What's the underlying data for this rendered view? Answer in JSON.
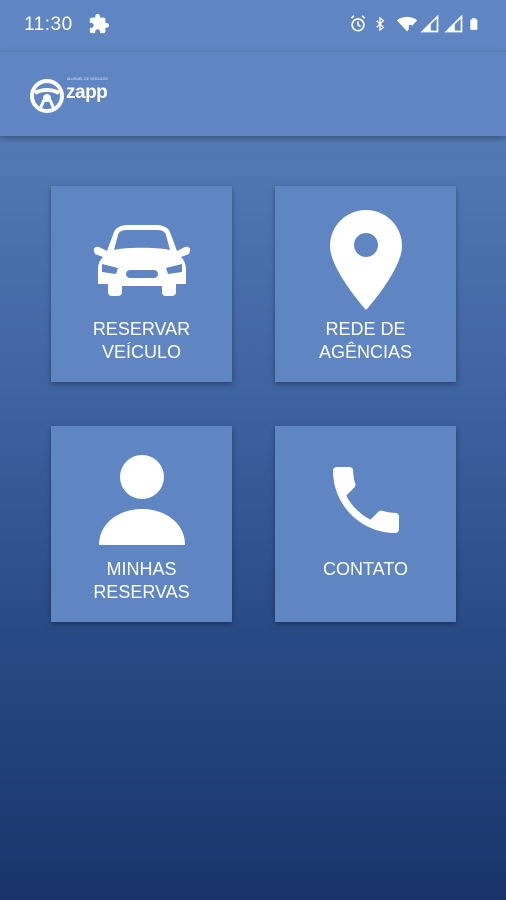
{
  "status_bar": {
    "time": "11:30",
    "icons": [
      "puzzle-icon",
      "alarm-icon",
      "bluetooth-icon",
      "wifi-icon",
      "signal-icon",
      "signal-icon",
      "battery-icon"
    ]
  },
  "app_bar": {
    "logo_text": "zapp",
    "logo_tagline": "ALUGUEL DE VEÍCULOS"
  },
  "tiles": [
    {
      "id": "reservar",
      "icon": "car-icon",
      "label_line1": "RESERVAR",
      "label_line2": "VEÍCULO"
    },
    {
      "id": "rede",
      "icon": "location-pin-icon",
      "label_line1": "REDE DE",
      "label_line2": "AGÊNCIAS"
    },
    {
      "id": "minhas",
      "icon": "person-icon",
      "label_line1": "MINHAS",
      "label_line2": "RESERVAS"
    },
    {
      "id": "contato",
      "icon": "phone-icon",
      "label_line1": "CONTATO",
      "label_line2": ""
    }
  ],
  "colors": {
    "primary": "#5f86c2",
    "background_top": "#5e86c0",
    "background_bottom": "#1a346b",
    "text": "#ffffff"
  }
}
